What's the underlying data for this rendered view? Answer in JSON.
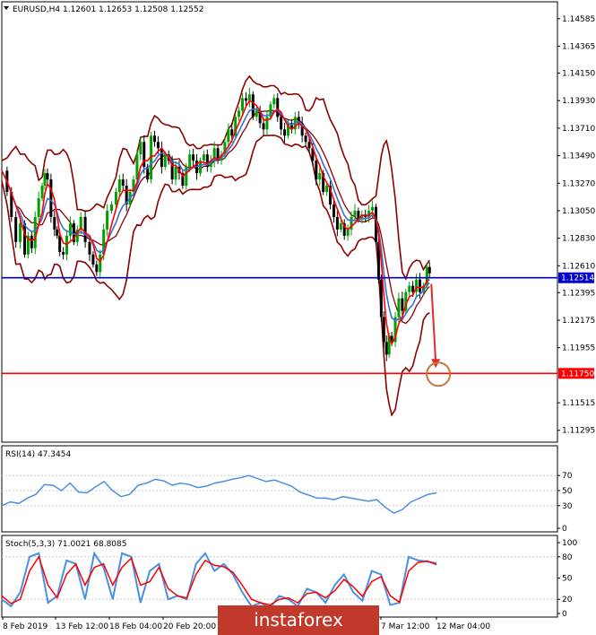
{
  "chart_data": {
    "type": "candlestick",
    "symbol_line": "EURUSD,H4  1.12601 1.12653 1.12508 1.12552",
    "price_axis": {
      "range": [
        1.112,
        1.1472
      ],
      "ticks": [
        "1.14585",
        "1.14365",
        "1.14150",
        "1.13930",
        "1.13710",
        "1.13490",
        "1.13270",
        "1.13050",
        "1.12830",
        "1.12610",
        "1.12395",
        "1.12175",
        "1.11955",
        "1.11515",
        "1.11295"
      ]
    },
    "levels": [
      {
        "value": 1.12514,
        "label": "1.12514",
        "color": "#0000cc"
      },
      {
        "value": 1.1175,
        "label": "1.11750",
        "color": "#ff0000"
      }
    ],
    "time_labels": [
      "8 Feb 2019",
      "13 Feb 12:00",
      "18 Feb 04:00",
      "20 Feb 20:00",
      "7 Mar 12:00",
      "12 Mar 04:00"
    ],
    "price_path": [
      [
        0,
        1.1337
      ],
      [
        6,
        1.132
      ],
      [
        11,
        1.13
      ],
      [
        16,
        1.128
      ],
      [
        21,
        1.1295
      ],
      [
        26,
        1.127
      ],
      [
        30,
        1.1285
      ],
      [
        34,
        1.1275
      ],
      [
        38,
        1.13
      ],
      [
        42,
        1.1315
      ],
      [
        46,
        1.1325
      ],
      [
        49,
        1.1335
      ],
      [
        52,
        1.133
      ],
      [
        56,
        1.13
      ],
      [
        60,
        1.129
      ],
      [
        63,
        1.1285
      ],
      [
        66,
        1.1272
      ],
      [
        70,
        1.127
      ],
      [
        74,
        1.1285
      ],
      [
        78,
        1.1295
      ],
      [
        82,
        1.128
      ],
      [
        86,
        1.129
      ],
      [
        90,
        1.13
      ],
      [
        95,
        1.128
      ],
      [
        100,
        1.127
      ],
      [
        104,
        1.1262
      ],
      [
        108,
        1.1256
      ],
      [
        112,
        1.127
      ],
      [
        116,
        1.129
      ],
      [
        120,
        1.1305
      ],
      [
        125,
        1.131
      ],
      [
        130,
        1.132
      ],
      [
        134,
        1.133
      ],
      [
        138,
        1.1325
      ],
      [
        142,
        1.131
      ],
      [
        146,
        1.132
      ],
      [
        150,
        1.133
      ],
      [
        154,
        1.135
      ],
      [
        158,
        1.136
      ],
      [
        162,
        1.134
      ],
      [
        166,
        1.133
      ],
      [
        170,
        1.1365
      ],
      [
        174,
        1.136
      ],
      [
        178,
        1.1355
      ],
      [
        182,
        1.134
      ],
      [
        186,
        1.135
      ],
      [
        190,
        1.1345
      ],
      [
        194,
        1.133
      ],
      [
        198,
        1.134
      ],
      [
        202,
        1.1335
      ],
      [
        206,
        1.1325
      ],
      [
        210,
        1.134
      ],
      [
        214,
        1.135
      ],
      [
        218,
        1.1345
      ],
      [
        222,
        1.1335
      ],
      [
        226,
        1.1345
      ],
      [
        230,
        1.135
      ],
      [
        234,
        1.134
      ],
      [
        238,
        1.1345
      ],
      [
        242,
        1.1355
      ],
      [
        246,
        1.1345
      ],
      [
        250,
        1.135
      ],
      [
        254,
        1.136
      ],
      [
        258,
        1.137
      ],
      [
        262,
        1.1365
      ],
      [
        266,
        1.138
      ],
      [
        270,
        1.1385
      ],
      [
        274,
        1.1395
      ],
      [
        278,
        1.1393
      ],
      [
        282,
        1.1398
      ],
      [
        286,
        1.138
      ],
      [
        290,
        1.1385
      ],
      [
        294,
        1.1375
      ],
      [
        298,
        1.137
      ],
      [
        302,
        1.138
      ],
      [
        306,
        1.139
      ],
      [
        310,
        1.1395
      ],
      [
        314,
        1.138
      ],
      [
        318,
        1.137
      ],
      [
        322,
        1.1365
      ],
      [
        326,
        1.1375
      ],
      [
        330,
        1.137
      ],
      [
        334,
        1.138
      ],
      [
        338,
        1.1375
      ],
      [
        342,
        1.1365
      ],
      [
        346,
        1.136
      ],
      [
        350,
        1.1355
      ],
      [
        354,
        1.1345
      ],
      [
        358,
        1.133
      ],
      [
        362,
        1.1335
      ],
      [
        366,
        1.132
      ],
      [
        370,
        1.1325
      ],
      [
        374,
        1.131
      ],
      [
        378,
        1.13
      ],
      [
        382,
        1.129
      ],
      [
        386,
        1.1295
      ],
      [
        390,
        1.1285
      ],
      [
        394,
        1.129
      ],
      [
        398,
        1.13
      ],
      [
        402,
        1.1305
      ],
      [
        406,
        1.1298
      ],
      [
        410,
        1.1302
      ],
      [
        414,
        1.13
      ],
      [
        418,
        1.1305
      ],
      [
        422,
        1.1308
      ],
      [
        426,
        1.128
      ],
      [
        429,
        1.125
      ],
      [
        432,
        1.122
      ],
      [
        435,
        1.12
      ],
      [
        438,
        1.119
      ],
      [
        441,
        1.1205
      ],
      [
        444,
        1.12
      ],
      [
        448,
        1.122
      ],
      [
        452,
        1.1235
      ],
      [
        456,
        1.1225
      ],
      [
        460,
        1.124
      ],
      [
        464,
        1.1245
      ],
      [
        468,
        1.124
      ],
      [
        472,
        1.125
      ],
      [
        476,
        1.124
      ],
      [
        480,
        1.1245
      ],
      [
        484,
        1.126
      ],
      [
        487,
        1.1255
      ]
    ],
    "forecast_arrow_target": [
      494,
      1.118
    ],
    "oscillators": [
      {
        "name": "RSI",
        "label": "RSI(14) 47.3454",
        "range": [
          0,
          100
        ],
        "ticks": [
          "70",
          "50",
          "30",
          "0"
        ],
        "tick_values": [
          70,
          50,
          30,
          0
        ],
        "levels": [
          70,
          50,
          30
        ],
        "series_color": "#4a90e2",
        "values": [
          30,
          35,
          33,
          40,
          45,
          58,
          57,
          50,
          60,
          48,
          47,
          55,
          62,
          50,
          42,
          45,
          57,
          60,
          65,
          63,
          57,
          60,
          58,
          54,
          56,
          60,
          62,
          65,
          67,
          70,
          66,
          62,
          64,
          60,
          56,
          48,
          44,
          40,
          40,
          38,
          42,
          40,
          38,
          36,
          38,
          28,
          20,
          25,
          35,
          40,
          45,
          47
        ]
      },
      {
        "name": "Stochastic",
        "label": "Stoch(5,3,3) 71.0021 68.8085",
        "range": [
          0,
          100
        ],
        "ticks": [
          "100",
          "80",
          "50",
          "20",
          "0"
        ],
        "tick_values": [
          100,
          80,
          50,
          20,
          0
        ],
        "levels": [
          80,
          20
        ],
        "series": [
          {
            "name": "main",
            "color": "#4a90e2",
            "values": [
              20,
              10,
              30,
              80,
              85,
              15,
              25,
              75,
              70,
              20,
              85,
              65,
              20,
              85,
              80,
              15,
              60,
              70,
              20,
              25,
              20,
              70,
              85,
              60,
              70,
              55,
              30,
              10,
              15,
              8,
              25,
              20,
              10,
              35,
              30,
              15,
              40,
              55,
              30,
              18,
              60,
              55,
              12,
              15,
              80,
              75,
              73,
              71
            ]
          },
          {
            "name": "signal",
            "color": "#ff0000",
            "values": [
              25,
              14,
              20,
              60,
              80,
              40,
              22,
              55,
              70,
              40,
              65,
              70,
              40,
              65,
              78,
              40,
              45,
              65,
              35,
              25,
              22,
              55,
              75,
              68,
              66,
              58,
              40,
              20,
              15,
              12,
              20,
              22,
              15,
              28,
              30,
              22,
              32,
              48,
              38,
              24,
              45,
              52,
              25,
              16,
              60,
              72,
              74,
              69
            ]
          }
        ]
      }
    ],
    "colors": {
      "candle_up": "#00a000",
      "candle_down": "#000000",
      "bollinger": "#8b0000",
      "ma_fast": "#ff0000",
      "ma_slow": "#3a6fd8",
      "forecast": "#e22b2b",
      "target_circle": "#c8763a"
    }
  },
  "watermark": {
    "text": "instaforex",
    "bg": "#c0392b"
  }
}
